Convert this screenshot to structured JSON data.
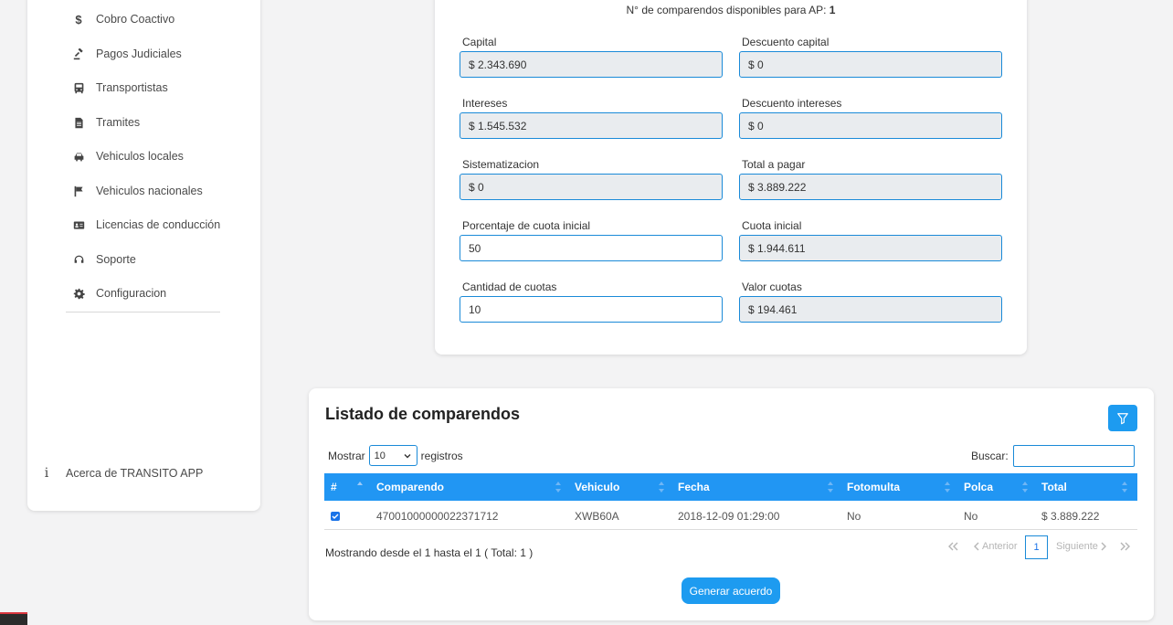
{
  "sidebar": {
    "items": [
      {
        "label": "Cobro Coactivo",
        "icon": "dollar-icon"
      },
      {
        "label": "Pagos Judiciales",
        "icon": "gavel-icon"
      },
      {
        "label": "Transportistas",
        "icon": "bus-icon"
      },
      {
        "label": "Tramites",
        "icon": "file-icon"
      },
      {
        "label": "Vehiculos locales",
        "icon": "car-icon"
      },
      {
        "label": "Vehiculos nacionales",
        "icon": "flag-icon"
      },
      {
        "label": "Licencias de conducción",
        "icon": "id-card-icon"
      },
      {
        "label": "Soporte",
        "icon": "headset-icon"
      },
      {
        "label": "Configuracion",
        "icon": "gear-icon"
      }
    ],
    "about_label": "Acerca de TRANSITO APP"
  },
  "summary": {
    "available_label": "N° de comparendos disponibles para AP:",
    "available_count": "1",
    "fields": {
      "capital": {
        "label": "Capital",
        "value": "$ 2.343.690"
      },
      "descuento_capital": {
        "label": "Descuento capital",
        "value": "$ 0"
      },
      "intereses": {
        "label": "Intereses",
        "value": "$ 1.545.532"
      },
      "descuento_intereses": {
        "label": "Descuento intereses",
        "value": "$ 0"
      },
      "sistematizacion": {
        "label": "Sistematizacion",
        "value": "$ 0"
      },
      "total_pagar": {
        "label": "Total a pagar",
        "value": "$ 3.889.222"
      },
      "porcentaje_cuota": {
        "label": "Porcentaje de cuota inicial",
        "value": "50"
      },
      "cuota_inicial": {
        "label": "Cuota inicial",
        "value": "$ 1.944.611"
      },
      "cantidad_cuotas": {
        "label": "Cantidad de cuotas",
        "value": "10"
      },
      "valor_cuotas": {
        "label": "Valor cuotas",
        "value": "$ 194.461"
      }
    }
  },
  "listado": {
    "title": "Listado de comparendos",
    "show_label": "Mostrar",
    "page_size": "10",
    "records_label": "registros",
    "search_label": "Buscar:",
    "search_value": "",
    "columns": [
      "#",
      "Comparendo",
      "Vehiculo",
      "Fecha",
      "Fotomulta",
      "Polca",
      "Total"
    ],
    "rows": [
      {
        "comparendo": "47001000000022371712",
        "vehiculo": "XWB60A",
        "fecha": "2018-12-09 01:29:00",
        "fotomulta": "No",
        "polca": "No",
        "total": "$ 3.889.222",
        "checked": true
      }
    ],
    "info": "Mostrando desde el 1 hasta el 1 ( Total: 1 )",
    "pager": {
      "previous": "Anterior",
      "next": "Siguiente",
      "current_page": "1"
    },
    "generate_button": "Generar acuerdo"
  },
  "colors": {
    "accent": "#2196f3",
    "button": "#1d9bf0",
    "border": "#1a8ad8",
    "readonly_bg": "#e9ecef"
  }
}
